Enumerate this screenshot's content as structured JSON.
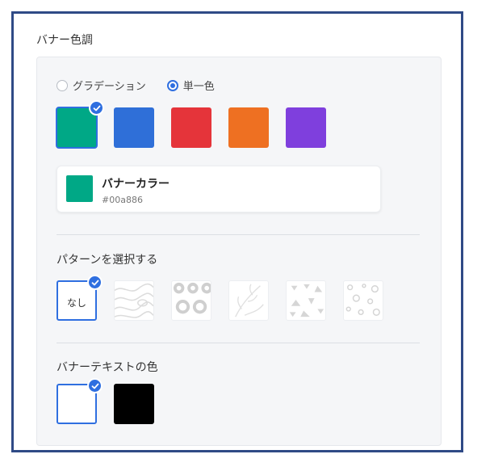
{
  "section_title": "バナー色調",
  "mode_options": [
    {
      "label": "グラデーション",
      "selected": false
    },
    {
      "label": "単一色",
      "selected": true
    }
  ],
  "colors": [
    "#00a886",
    "#2f6fd8",
    "#e5343a",
    "#ee7022",
    "#7f3fdd"
  ],
  "selected_color_index": 0,
  "banner_color": {
    "name": "バナーカラー",
    "hex": "#00a886"
  },
  "pattern_title": "パターンを選択する",
  "patterns": [
    {
      "id": "none",
      "label": "なし",
      "selected": true
    },
    {
      "id": "topography",
      "label": "",
      "selected": false
    },
    {
      "id": "circles",
      "label": "",
      "selected": false
    },
    {
      "id": "leaves",
      "label": "",
      "selected": false
    },
    {
      "id": "triangles",
      "label": "",
      "selected": false
    },
    {
      "id": "bubbles",
      "label": "",
      "selected": false
    }
  ],
  "text_color_title": "バナーテキストの色",
  "text_colors": [
    {
      "color": "#ffffff",
      "selected": true
    },
    {
      "color": "#000000",
      "selected": false
    }
  ],
  "accent_color": "#2f6fe0"
}
